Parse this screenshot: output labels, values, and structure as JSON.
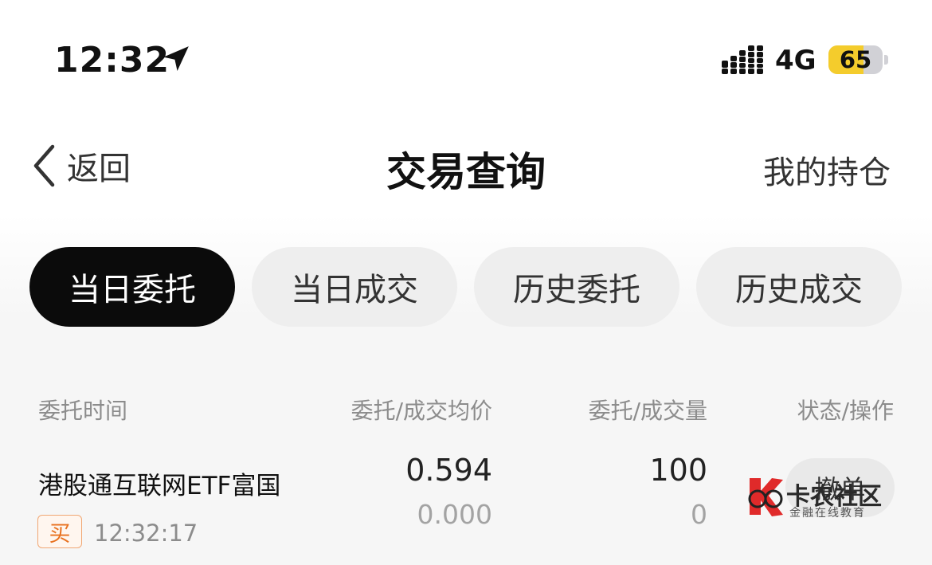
{
  "status_bar": {
    "time": "12:32",
    "network": "4G",
    "battery": "65",
    "battery_level": 0.65
  },
  "nav": {
    "back_label": "返回",
    "title": "交易查询",
    "right_action": "我的持仓"
  },
  "tabs": [
    {
      "label": "当日委托",
      "active": true
    },
    {
      "label": "当日成交",
      "active": false
    },
    {
      "label": "历史委托",
      "active": false
    },
    {
      "label": "历史成交",
      "active": false
    }
  ],
  "table": {
    "headers": [
      "委托时间",
      "委托/成交均价",
      "委托/成交量",
      "状态/操作"
    ],
    "rows": [
      {
        "name": "港股通互联网ETF富国",
        "side": "买",
        "time": "12:32:17",
        "order_price": "0.594",
        "deal_avg_price": "0.000",
        "order_qty": "100",
        "deal_qty": "0",
        "action": "撤单"
      }
    ]
  },
  "watermark": {
    "brand": "卡农社区",
    "tagline": "金融在线教育"
  },
  "colors": {
    "active_tab_bg": "#0b0b0b",
    "buy_badge": "#e8711f",
    "battery_fill": "#f4cc2c"
  }
}
